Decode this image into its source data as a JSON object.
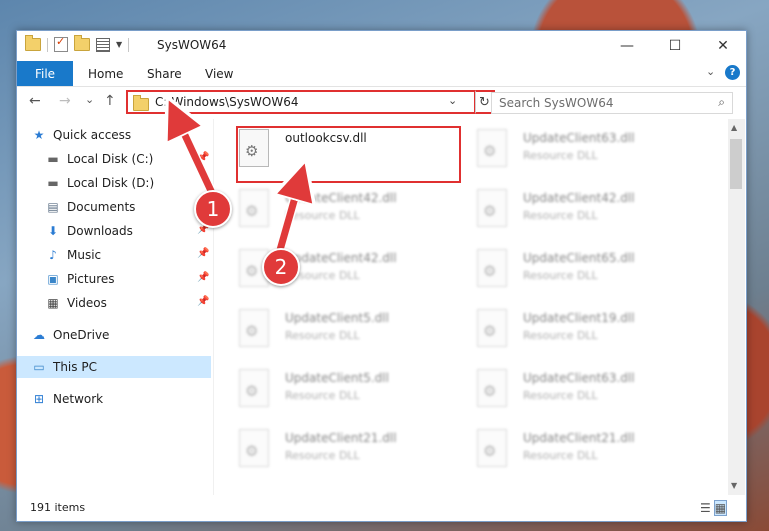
{
  "window": {
    "title": "SysWOW64",
    "controls": {
      "minimize": "—",
      "maximize": "☐",
      "close": "✕"
    }
  },
  "ribbon": {
    "tabs": [
      "File",
      "Home",
      "Share",
      "View"
    ],
    "collapse_icon": "chevron-down-icon",
    "help_label": "?"
  },
  "navigation": {
    "back": "←",
    "forward": "→",
    "recent": "⌄",
    "up": "↑"
  },
  "address": {
    "path": "C:\\Windows\\SysWOW64",
    "dropdown": "⌄",
    "refresh": "↻"
  },
  "search": {
    "placeholder": "Search SysWOW64",
    "icon": "⌕"
  },
  "sidebar": {
    "items": [
      {
        "label": "Quick access",
        "icon": "★",
        "pinned": false
      },
      {
        "label": "Local Disk (C:)",
        "icon": "▬",
        "pinned": true
      },
      {
        "label": "Local Disk (D:)",
        "icon": "▬",
        "pinned": true
      },
      {
        "label": "Documents",
        "icon": "▤",
        "pinned": true
      },
      {
        "label": "Downloads",
        "icon": "⬇",
        "pinned": true
      },
      {
        "label": "Music",
        "icon": "♪",
        "pinned": true
      },
      {
        "label": "Pictures",
        "icon": "▣",
        "pinned": true
      },
      {
        "label": "Videos",
        "icon": "▦",
        "pinned": true
      },
      {
        "label": "OneDrive",
        "icon": "☁",
        "pinned": false
      },
      {
        "label": "This PC",
        "icon": "▭",
        "pinned": false,
        "selected": true
      },
      {
        "label": "Network",
        "icon": "⊞",
        "pinned": false
      }
    ]
  },
  "files": {
    "left": [
      {
        "name": "outlookcsv.dll",
        "type": ""
      },
      {
        "name": "UpdateClient42.dll",
        "type": "Resource DLL"
      },
      {
        "name": "UpdateClient42.dll",
        "type": "Resource DLL"
      },
      {
        "name": "UpdateClient5.dll",
        "type": "Resource DLL"
      },
      {
        "name": "UpdateClient5.dll",
        "type": "Resource DLL"
      },
      {
        "name": "UpdateClient21.dll",
        "type": "Resource DLL"
      }
    ],
    "right": [
      {
        "name": "UpdateClient63.dll",
        "type": "Resource DLL"
      },
      {
        "name": "UpdateClient42.dll",
        "type": "Resource DLL"
      },
      {
        "name": "UpdateClient65.dll",
        "type": "Resource DLL"
      },
      {
        "name": "UpdateClient19.dll",
        "type": "Resource DLL"
      },
      {
        "name": "UpdateClient63.dll",
        "type": "Resource DLL"
      },
      {
        "name": "UpdateClient21.dll",
        "type": "Resource DLL"
      }
    ]
  },
  "status": {
    "item_count": "191 items"
  },
  "annotations": {
    "step1": "1",
    "step2": "2",
    "color": "#e03a3a"
  }
}
